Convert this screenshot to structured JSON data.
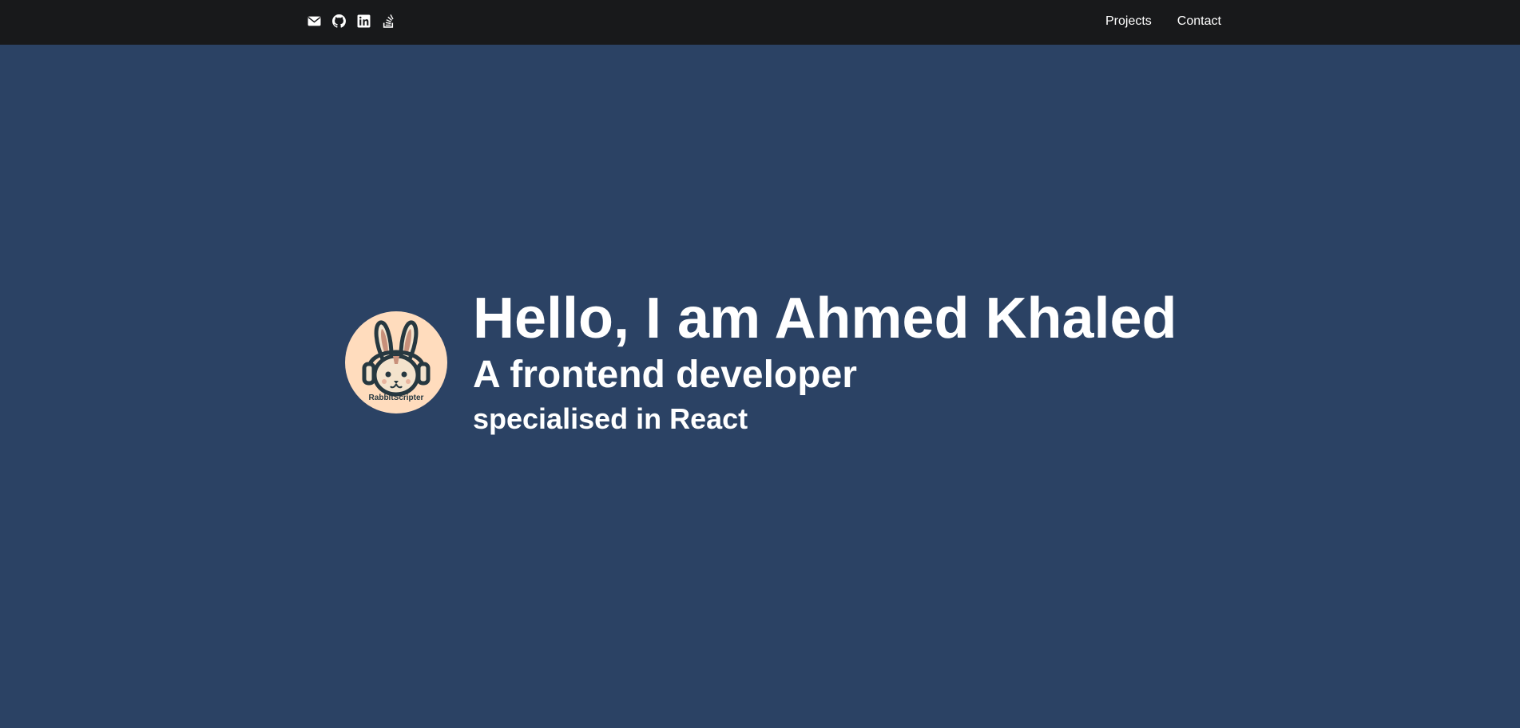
{
  "nav": {
    "social": [
      {
        "icon": "envelope-icon",
        "label": "Email"
      },
      {
        "icon": "github-icon",
        "label": "GitHub"
      },
      {
        "icon": "linkedin-icon",
        "label": "LinkedIn"
      },
      {
        "icon": "stackoverflow-icon",
        "label": "Stack Overflow"
      }
    ],
    "links": {
      "projects": "Projects",
      "contact": "Contact"
    }
  },
  "hero": {
    "logo_text": "RabbitScripter",
    "title": "Hello, I am Ahmed Khaled",
    "subtitle": "A frontend developer",
    "tagline": "specialised in React"
  },
  "colors": {
    "navbar_bg": "#18191b",
    "page_bg": "#2b4264",
    "avatar_bg": "#ffdcbd",
    "text": "#ffffff"
  }
}
